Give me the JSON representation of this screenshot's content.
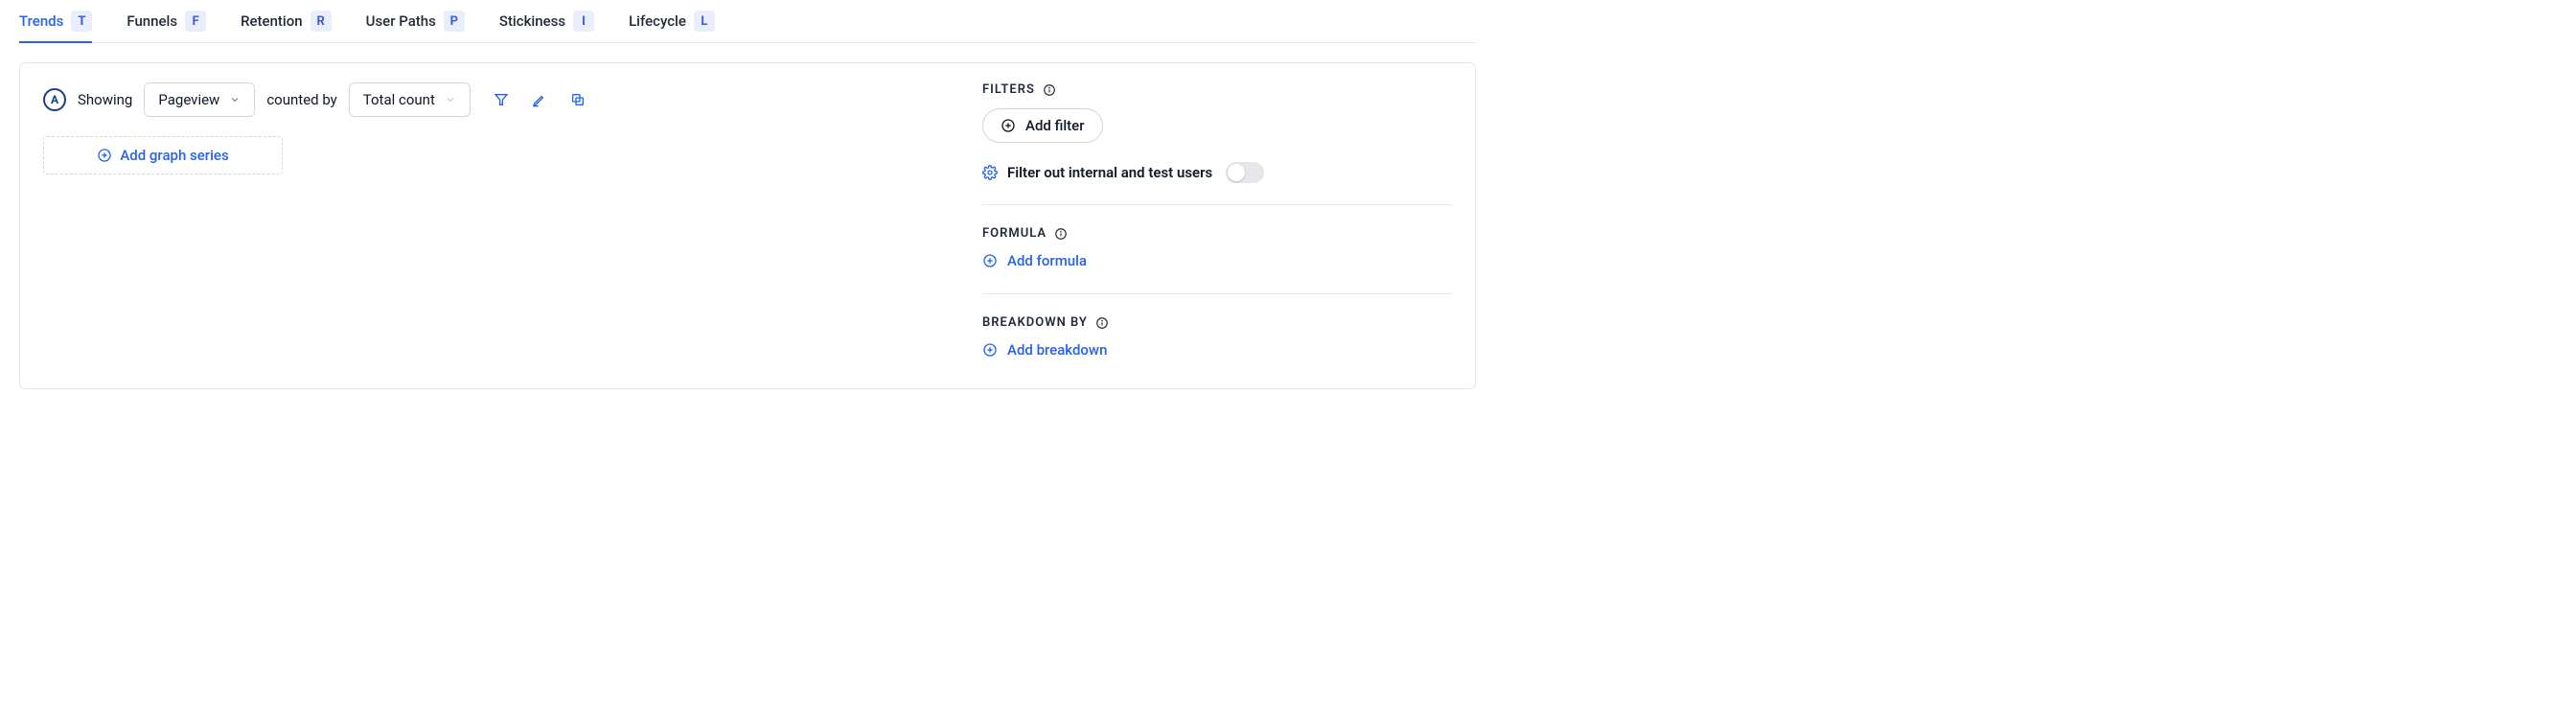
{
  "tabs": [
    {
      "label": "Trends",
      "key": "T",
      "active": true
    },
    {
      "label": "Funnels",
      "key": "F",
      "active": false
    },
    {
      "label": "Retention",
      "key": "R",
      "active": false
    },
    {
      "label": "User Paths",
      "key": "P",
      "active": false
    },
    {
      "label": "Stickiness",
      "key": "I",
      "active": false
    },
    {
      "label": "Lifecycle",
      "key": "L",
      "active": false
    }
  ],
  "series": {
    "badge": "A",
    "showing_label": "Showing",
    "event": "Pageview",
    "counted_by_label": "counted by",
    "count_type": "Total count"
  },
  "add_series_label": "Add graph series",
  "filters": {
    "heading": "FILTERS",
    "add_label": "Add filter",
    "internal_label": "Filter out internal and test users"
  },
  "formula": {
    "heading": "FORMULA",
    "add_label": "Add formula"
  },
  "breakdown": {
    "heading": "BREAKDOWN BY",
    "add_label": "Add breakdown"
  }
}
